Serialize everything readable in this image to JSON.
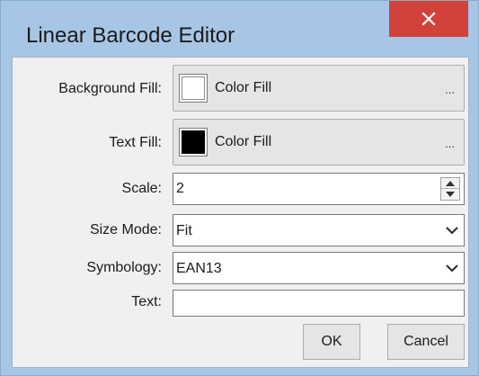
{
  "window": {
    "title": "Linear Barcode Editor",
    "close_icon": "close-icon"
  },
  "form": {
    "background_fill": {
      "label": "Background Fill:",
      "button_text": "Color Fill",
      "ellipsis": "...",
      "swatch_color": "#ffffff"
    },
    "text_fill": {
      "label": "Text Fill:",
      "button_text": "Color Fill",
      "ellipsis": "...",
      "swatch_color": "#000000"
    },
    "scale": {
      "label": "Scale:",
      "value": "2"
    },
    "size_mode": {
      "label": "Size Mode:",
      "value": "Fit"
    },
    "symbology": {
      "label": "Symbology:",
      "value": "EAN13"
    },
    "text": {
      "label": "Text:",
      "value": ""
    }
  },
  "buttons": {
    "ok": "OK",
    "cancel": "Cancel"
  },
  "colors": {
    "frame": "#a7c6e6",
    "close_button": "#d2413a",
    "client": "#f0f0f0"
  }
}
